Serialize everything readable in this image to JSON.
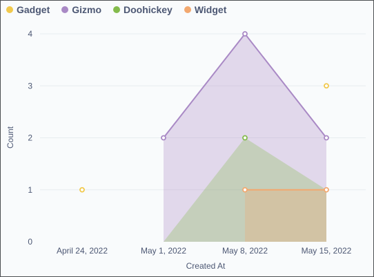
{
  "chart_data": {
    "type": "area",
    "xlabel": "Created At",
    "ylabel": "Count",
    "ylim": [
      0,
      4
    ],
    "yticks": [
      "0",
      "1",
      "2",
      "3",
      "4"
    ],
    "categories": [
      "April 24, 2022",
      "May 1, 2022",
      "May 8, 2022",
      "May 15, 2022"
    ],
    "grid": true,
    "legend_position": "top-left",
    "series": [
      {
        "name": "Gadget",
        "display": "points",
        "color": "#f1c94c",
        "values": [
          1,
          null,
          null,
          3
        ]
      },
      {
        "name": "Gizmo",
        "display": "area",
        "color": "#a989c5",
        "values": [
          null,
          2,
          4,
          2
        ]
      },
      {
        "name": "Doohickey",
        "display": "area",
        "color": "#84bb4c",
        "values": [
          null,
          0,
          2,
          1
        ]
      },
      {
        "name": "Widget",
        "display": "area",
        "color": "#f2a86f",
        "values": [
          null,
          null,
          1,
          1
        ]
      }
    ]
  }
}
